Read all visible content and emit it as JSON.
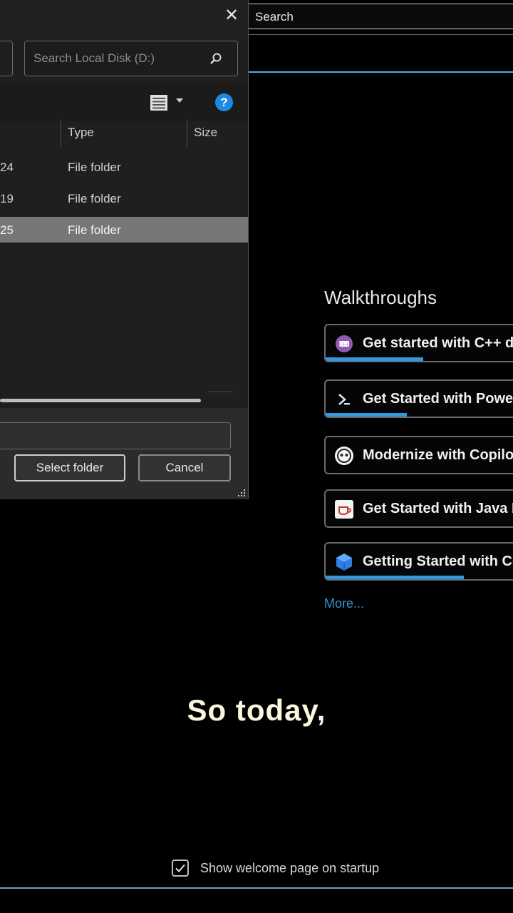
{
  "background": {
    "search": {
      "label": "Search"
    },
    "walkthroughs": {
      "title": "Walkthroughs",
      "items": [
        {
          "label": "Get started with C++ d",
          "icon": "cpp-icon",
          "progress": 0.48
        },
        {
          "label": "Get Started with Power",
          "icon": "powershell-icon",
          "progress": 0.4
        },
        {
          "label": "Modernize with Copilo",
          "icon": "copilot-icon",
          "progress": 0
        },
        {
          "label": "Get Started with Java D",
          "icon": "java-icon",
          "progress": 0
        },
        {
          "label": "Getting Started with Co",
          "icon": "cube-icon",
          "progress": 0.68
        }
      ],
      "more_label": "More..."
    },
    "startup": {
      "label": "Show welcome page on startup",
      "checked": true
    }
  },
  "caption": "So today,",
  "dialog": {
    "search_placeholder": "Search Local Disk (D:)",
    "columns": {
      "type": "Type",
      "size": "Size"
    },
    "rows": [
      {
        "date": "24",
        "type": "File folder",
        "selected": false
      },
      {
        "date": "19",
        "type": "File folder",
        "selected": false
      },
      {
        "date": "25",
        "type": "File folder",
        "selected": true
      }
    ],
    "folder_input_value": "",
    "buttons": {
      "select": "Select folder",
      "cancel": "Cancel"
    },
    "close_glyph": "✕",
    "help_glyph": "?"
  },
  "colors": {
    "accent_blue": "#2e9be0",
    "link_blue": "#3794d9",
    "caption": "#fbf7dc",
    "selected_row": "#777777"
  }
}
